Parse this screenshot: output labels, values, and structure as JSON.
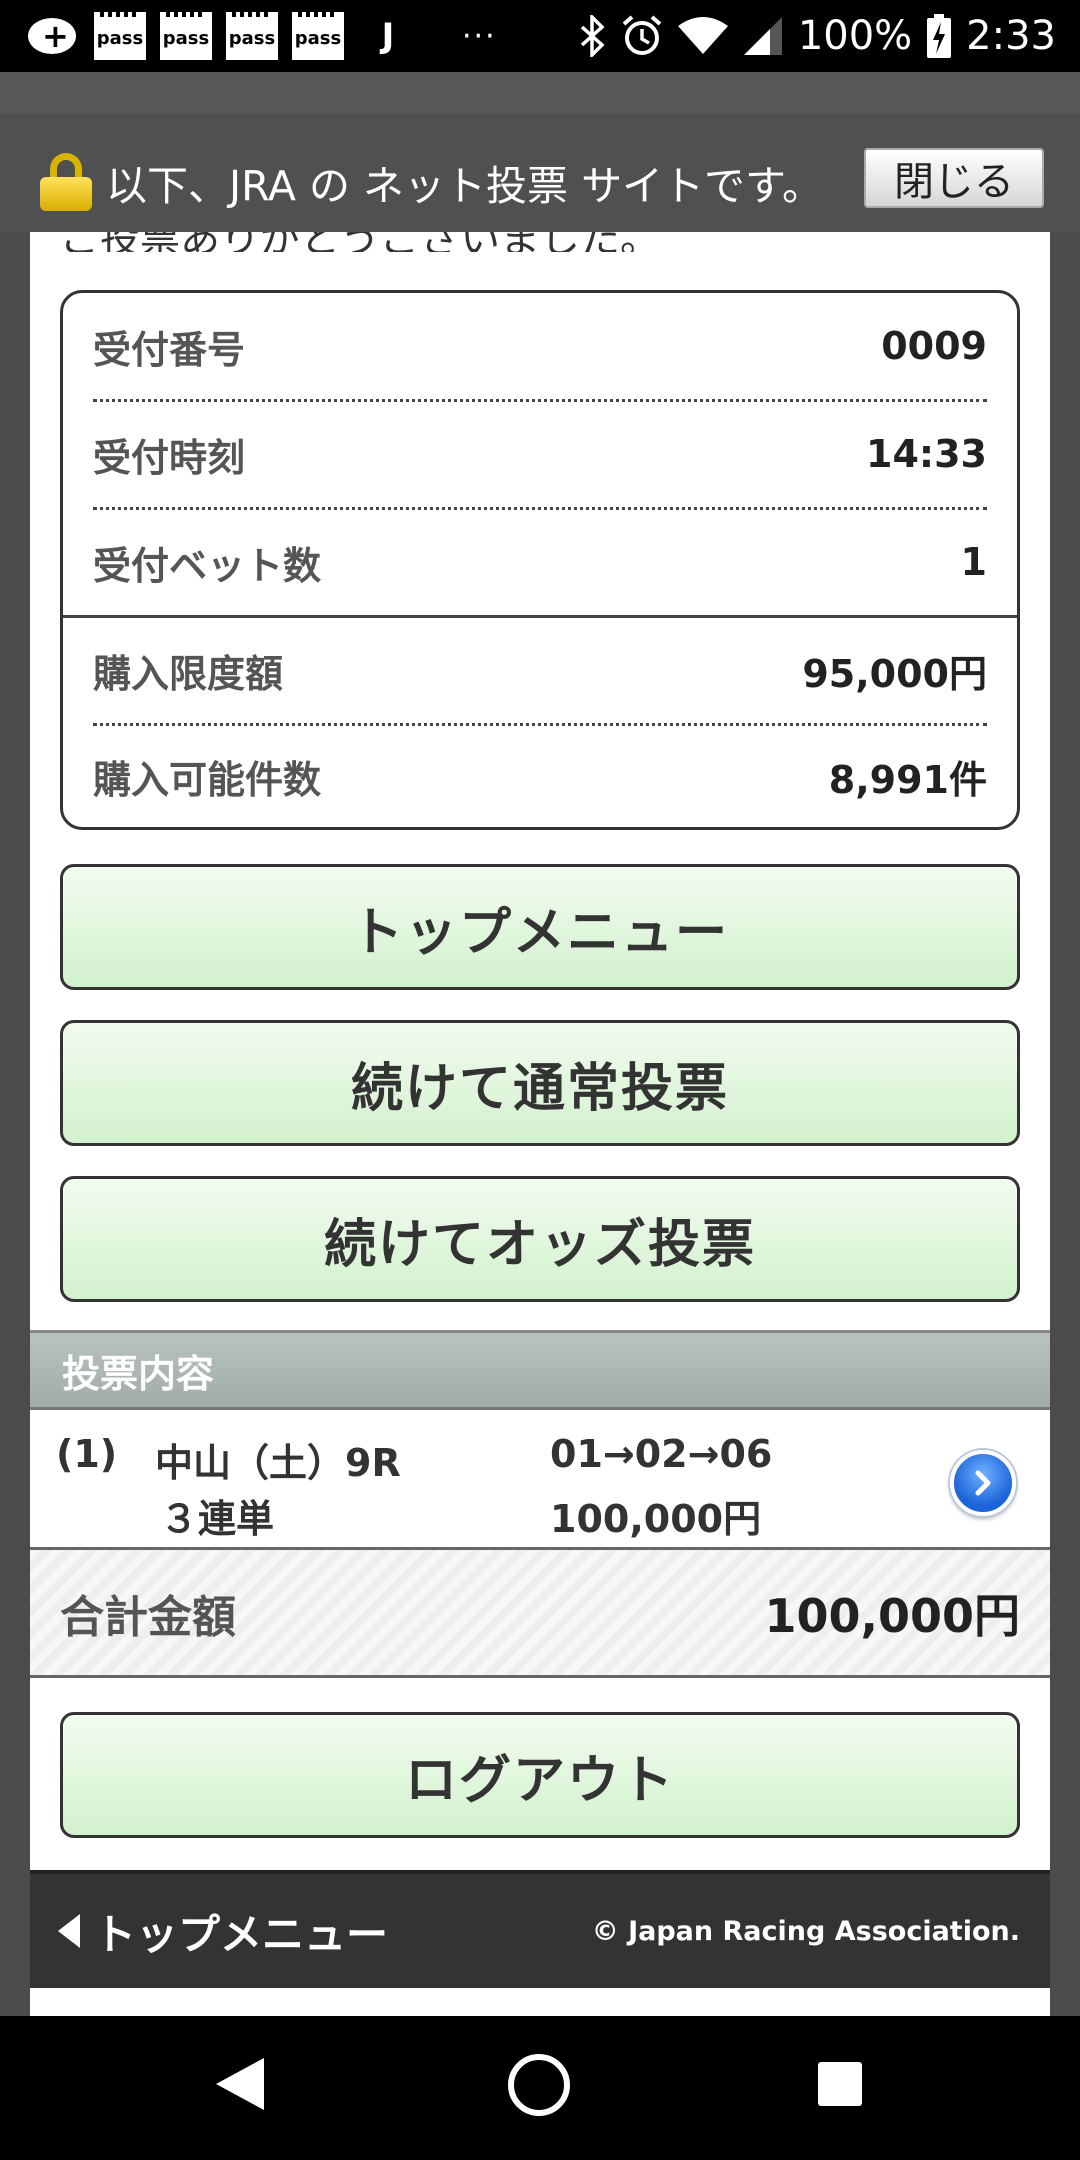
{
  "status_bar": {
    "pass_label": "pass",
    "j_label": "J",
    "more_label": "···",
    "battery": "100%",
    "time": "2:33"
  },
  "banner": {
    "text": "以下、JRA の ネット投票 サイトです。",
    "close_label": "閉じる"
  },
  "partial_text": "ご投票ありがとうございました。",
  "info": {
    "rows": [
      {
        "label": "受付番号",
        "value": "0009"
      },
      {
        "label": "受付時刻",
        "value": "14:33"
      },
      {
        "label": "受付ベット数",
        "value": "1"
      },
      {
        "label": "購入限度額",
        "value": "95,000円"
      },
      {
        "label": "購入可能件数",
        "value": "8,991件"
      }
    ]
  },
  "buttons": {
    "top_menu": "トップメニュー",
    "continue_normal": "続けて通常投票",
    "continue_odds": "続けてオッズ投票",
    "logout": "ログアウト"
  },
  "bet_section": {
    "title": "投票内容",
    "items": [
      {
        "num": "(1)",
        "venue": "中山（土）9R",
        "type": "３連単",
        "combo": "01→02→06",
        "amount": "100,000円"
      }
    ]
  },
  "total": {
    "label": "合計金額",
    "value": "100,000円"
  },
  "footer": {
    "back_label": "トップメニュー",
    "copyright": "© Japan Racing Association."
  },
  "colors": {
    "button_green_top": "#f2fcf0",
    "button_green_bottom": "#d2f1cd",
    "section_head": "#a1aca6",
    "footer_bg": "#333333"
  }
}
